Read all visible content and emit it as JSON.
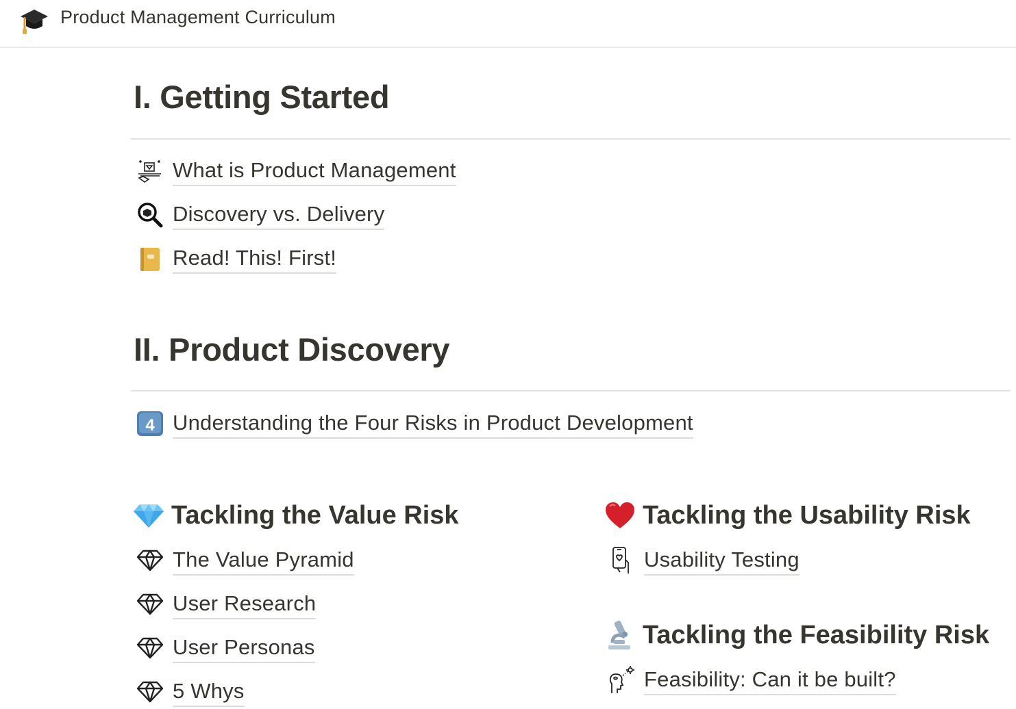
{
  "header": {
    "title": "Product Management Curriculum",
    "icon": "graduation-cap-icon"
  },
  "sections": [
    {
      "title": "I. Getting Started",
      "links": [
        {
          "label": "What is Product Management",
          "icon": "hand-gift-diamond-icon"
        },
        {
          "label": "Discovery vs. Delivery",
          "icon": "magnifier-box-icon"
        },
        {
          "label": "Read! This! First!",
          "icon": "yellow-notebook-icon"
        }
      ]
    },
    {
      "title": "II. Product Discovery",
      "links": [
        {
          "label": "Understanding the Four Risks in Product Development",
          "icon": "keycap-4-icon",
          "icon_text": "4"
        }
      ]
    }
  ],
  "columns": {
    "left": {
      "heading": "Tackling the Value Risk",
      "heading_icon": "gem-stone-icon",
      "links": [
        {
          "label": "The Value Pyramid",
          "icon": "diamond-outline-icon"
        },
        {
          "label": "User Research",
          "icon": "diamond-outline-icon"
        },
        {
          "label": "User Personas",
          "icon": "diamond-outline-icon"
        },
        {
          "label": "5 Whys",
          "icon": "diamond-outline-icon"
        }
      ]
    },
    "right": {
      "groups": [
        {
          "heading": "Tackling the Usability Risk",
          "heading_icon": "red-heart-icon",
          "links": [
            {
              "label": "Usability Testing",
              "icon": "phone-heart-hand-icon"
            }
          ]
        },
        {
          "heading": "Tackling the Feasibility Risk",
          "heading_icon": "microscope-icon",
          "links": [
            {
              "label": "Feasibility: Can it be built?",
              "icon": "head-idea-icon"
            }
          ]
        }
      ]
    }
  }
}
